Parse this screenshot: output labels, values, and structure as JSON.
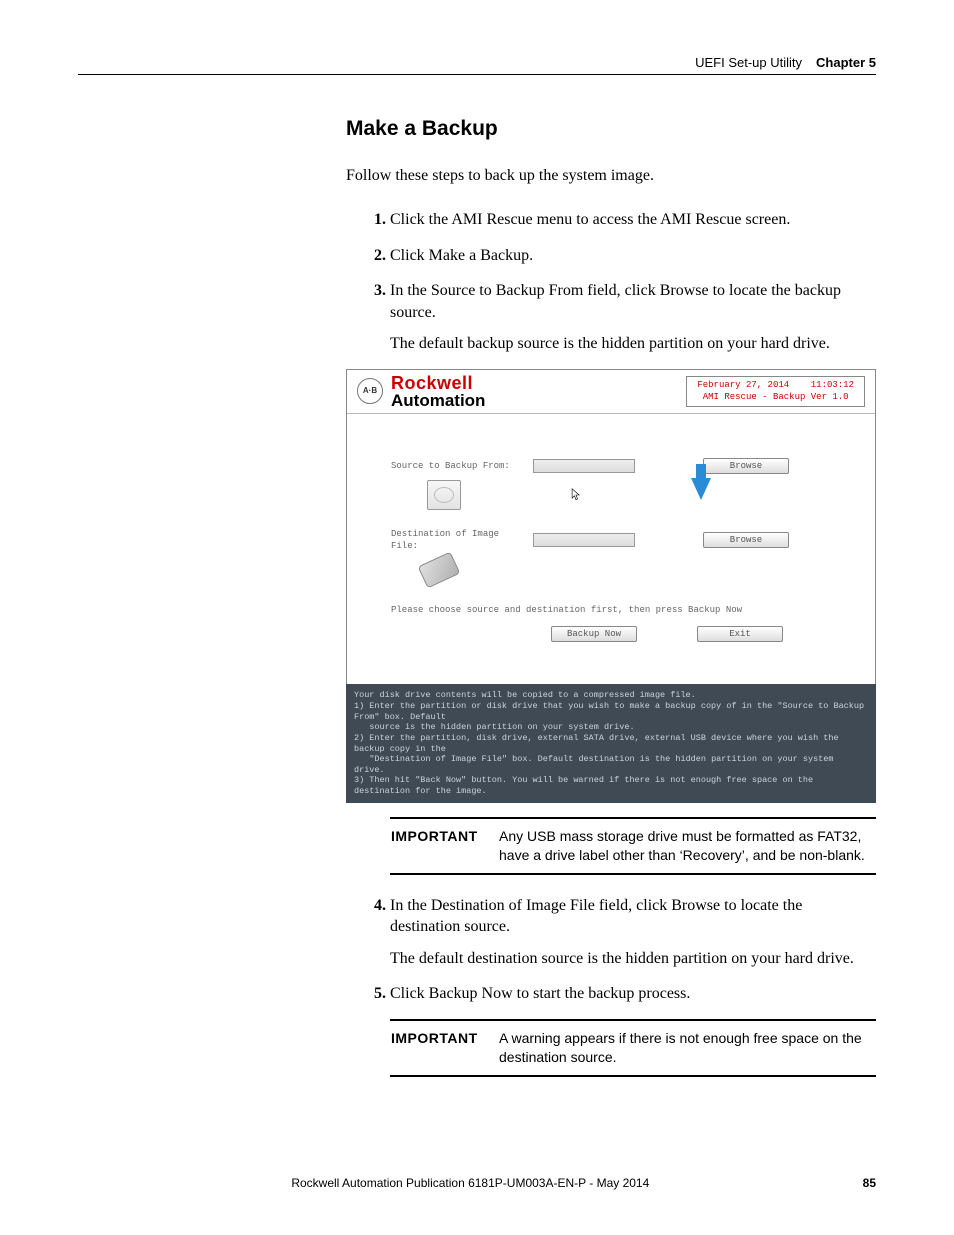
{
  "header": {
    "section": "UEFI Set-up Utility",
    "chapter": "Chapter 5"
  },
  "title": "Make a Backup",
  "intro": "Follow these steps to back up the system image.",
  "steps": {
    "s1": "Click the AMI Rescue menu to access the AMI Rescue screen.",
    "s2": "Click Make a Backup.",
    "s3": "In the Source to Backup From field, click Browse to locate the backup source.",
    "s3_sub": "The default backup source is the hidden partition on your hard drive.",
    "s4": "In the Destination of Image File field, click Browse to locate the destination source.",
    "s4_sub": "The default destination source is the hidden partition on your hard drive.",
    "s5": "Click Backup Now to start the backup process."
  },
  "screenshot": {
    "badge": "A·B",
    "brand_top": "Rockwell",
    "brand_bot": "Automation",
    "date": "February 27, 2014",
    "time": "11:03:12",
    "version": "AMI Rescue - Backup Ver 1.0",
    "lbl_source": "Source to Backup From:",
    "lbl_dest": "Destination of Image File:",
    "btn_browse": "Browse",
    "note": "Please choose source and destination first, then press Backup Now",
    "btn_backup": "Backup Now",
    "btn_exit": "Exit",
    "help": "Your disk drive contents will be copied to a compressed image file.\n1) Enter the partition or disk drive that you wish to make a backup copy of in the \"Source to Backup From\" box. Default\n   source is the hidden partition on your system drive.\n2) Enter the partition, disk drive, external SATA drive, external USB device where you wish the backup copy in the\n   \"Destination of Image File\" box. Default destination is the hidden partition on your system drive.\n3) Then hit \"Back Now\" button. You will be warned if there is not enough free space on the destination for the image."
  },
  "important1": {
    "label": "IMPORTANT",
    "text": "Any USB mass storage drive must be formatted as FAT32, have a drive label other than ‘Recovery’, and be non-blank."
  },
  "important2": {
    "label": "IMPORTANT",
    "text": "A warning appears if there is not enough free space on the destination source."
  },
  "footer": {
    "publication": "Rockwell Automation Publication 6181P-UM003A-EN-P - May 2014",
    "page": "85"
  }
}
